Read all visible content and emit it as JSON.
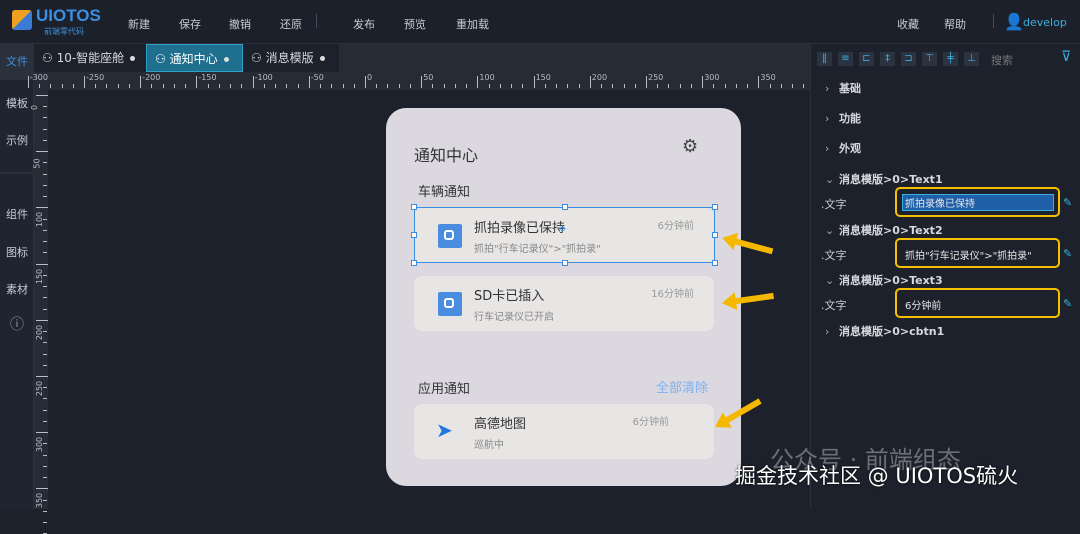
{
  "header": {
    "logo": "UIOTOS",
    "logo_sub": "前端零代码",
    "menu": [
      "新建",
      "保存",
      "撤销",
      "还原",
      "发布",
      "预览",
      "重加载"
    ],
    "right_menu": [
      "收藏",
      "帮助"
    ],
    "user": "develop"
  },
  "leftbar": [
    "文件",
    "模板",
    "示例",
    "组件",
    "图标",
    "素材"
  ],
  "tabs": [
    {
      "label": "10-智能座舱"
    },
    {
      "label": "通知中心"
    },
    {
      "label": "消息模版"
    }
  ],
  "ruler": {
    "h": [
      "-300",
      "-250",
      "-200",
      "-150",
      "-100",
      "-50",
      "0",
      "50",
      "100",
      "150",
      "200",
      "250",
      "300",
      "350"
    ],
    "v": [
      "0",
      "50",
      "100",
      "150",
      "200",
      "250",
      "300",
      "350"
    ]
  },
  "card": {
    "title": "通知中心",
    "vehicle_section": "车辆通知",
    "app_section": "应用通知",
    "clear_all": "全部清除",
    "items": [
      {
        "title": "抓拍录像已保持",
        "sub": "抓拍\"行车记录仪\">\"抓拍录\"",
        "time": "6分钟前"
      },
      {
        "title": "SD卡已插入",
        "sub": "行车记录仪已开启",
        "time": "16分钟前"
      },
      {
        "title": "高德地图",
        "sub": "巡航中",
        "time": "6分钟前"
      }
    ]
  },
  "panel": {
    "search": "搜索",
    "groups": [
      "基础",
      "功能",
      "外观"
    ],
    "props": [
      {
        "group": "消息模版>0>Text1",
        "label": ".文字",
        "value": "抓拍录像已保持"
      },
      {
        "group": "消息模版>0>Text2",
        "label": ".文字",
        "value": "抓拍\"行车记录仪\">\"抓拍录\""
      },
      {
        "group": "消息模版>0>Text3",
        "label": ".文字",
        "value": "6分钟前"
      }
    ],
    "last_group": "消息模版>0>cbtn1"
  },
  "watermark": {
    "main": "掘金技术社区 @ UIOTOS硫火",
    "sub": "公众号 · 前端组态"
  },
  "colors": {
    "accent": "#3b8fe0",
    "highlight": "#f5c000"
  }
}
